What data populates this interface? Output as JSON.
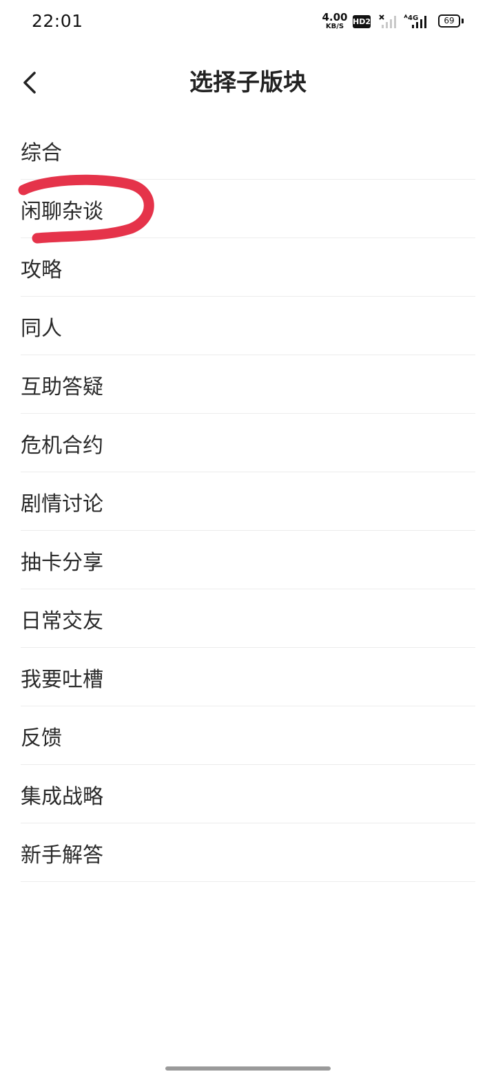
{
  "status_bar": {
    "time": "22:01",
    "net_speed_value": "4.00",
    "net_speed_unit": "KB/S",
    "hd_label": "HD2",
    "network_type": "4G",
    "battery": "69"
  },
  "header": {
    "title": "选择子版块"
  },
  "list": {
    "items": [
      {
        "label": "综合"
      },
      {
        "label": "闲聊杂谈"
      },
      {
        "label": "攻略"
      },
      {
        "label": "同人"
      },
      {
        "label": "互助答疑"
      },
      {
        "label": "危机合约"
      },
      {
        "label": "剧情讨论"
      },
      {
        "label": "抽卡分享"
      },
      {
        "label": "日常交友"
      },
      {
        "label": "我要吐槽"
      },
      {
        "label": "反馈"
      },
      {
        "label": "集成战略"
      },
      {
        "label": "新手解答"
      }
    ]
  },
  "colors": {
    "scribble": "#e5334a",
    "divider": "#ececec",
    "text": "#2a2a2a"
  }
}
